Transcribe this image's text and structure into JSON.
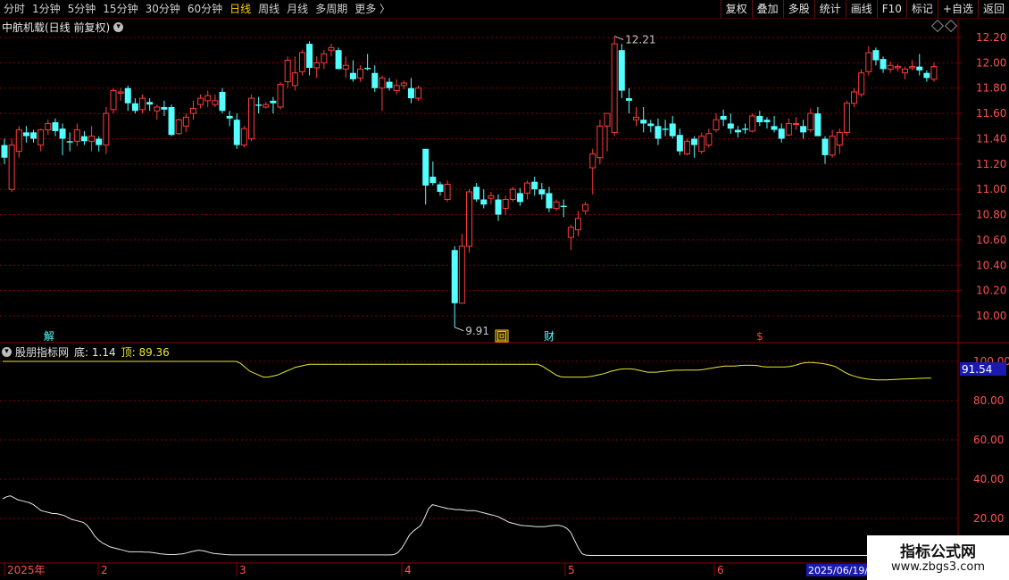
{
  "toolbar": {
    "periods": [
      "分时",
      "1分钟",
      "5分钟",
      "15分钟",
      "30分钟",
      "60分钟",
      "日线",
      "周线",
      "月线",
      "多周期",
      "更多 〉"
    ],
    "active_period": "日线",
    "buttons": [
      "复权",
      "叠加",
      "多股",
      "统计",
      "画线",
      "F10",
      "标记",
      "+自选",
      "返回"
    ]
  },
  "main_title": "中航机载(日线 前复权)",
  "indicator": {
    "name": "股朋指标网",
    "bottom_label": "底: 1.14",
    "top_label": "顶: 89.36",
    "current_value": "91.54",
    "axis_labels": [
      "100.00",
      "80.00",
      "60.00",
      "40.00",
      "20.00"
    ],
    "colors": {
      "bottom": "#e8e8e8",
      "top": "#e8e830"
    }
  },
  "price_axis": [
    "12.20",
    "12.00",
    "11.80",
    "11.60",
    "11.40",
    "11.20",
    "11.00",
    "10.80",
    "10.60",
    "10.40",
    "10.20",
    "10.00"
  ],
  "annotations": {
    "high": "12.21",
    "low": "9.91"
  },
  "event_badges": [
    "解",
    "回",
    "财",
    "$"
  ],
  "date_axis": [
    "2025年",
    "2",
    "3",
    "4",
    "5",
    "6",
    "2025/06/19/四"
  ],
  "watermark": {
    "title": "指标公式网",
    "url": "www.zbgs3.com"
  },
  "colors": {
    "up": "#ff3b3b",
    "down": "#54ffff",
    "grid": "#8a0000",
    "axis_text": "#ff5050"
  },
  "chart_data": {
    "type": "candlestick",
    "candles": [
      [
        11.35,
        11.4,
        11.2,
        11.25
      ],
      [
        11.0,
        11.4,
        10.98,
        11.35
      ],
      [
        11.3,
        11.5,
        11.25,
        11.47
      ],
      [
        11.45,
        11.5,
        11.37,
        11.42
      ],
      [
        11.45,
        11.47,
        11.37,
        11.4
      ],
      [
        11.35,
        11.48,
        11.3,
        11.47
      ],
      [
        11.47,
        11.55,
        11.43,
        11.52
      ],
      [
        11.53,
        11.56,
        11.42,
        11.46
      ],
      [
        11.48,
        11.52,
        11.27,
        11.4
      ],
      [
        11.38,
        11.45,
        11.3,
        11.37
      ],
      [
        11.38,
        11.52,
        11.34,
        11.47
      ],
      [
        11.42,
        11.46,
        11.35,
        11.38
      ],
      [
        11.38,
        11.5,
        11.3,
        11.42
      ],
      [
        11.4,
        11.42,
        11.3,
        11.35
      ],
      [
        11.35,
        11.65,
        11.28,
        11.6
      ],
      [
        11.63,
        11.8,
        11.6,
        11.78
      ],
      [
        11.76,
        11.8,
        11.7,
        11.77
      ],
      [
        11.8,
        11.82,
        11.62,
        11.68
      ],
      [
        11.68,
        11.72,
        11.6,
        11.62
      ],
      [
        11.63,
        11.75,
        11.6,
        11.72
      ],
      [
        11.69,
        11.72,
        11.62,
        11.67
      ],
      [
        11.62,
        11.67,
        11.55,
        11.65
      ],
      [
        11.65,
        11.7,
        11.58,
        11.63
      ],
      [
        11.65,
        11.67,
        11.42,
        11.43
      ],
      [
        11.44,
        11.56,
        11.43,
        11.55
      ],
      [
        11.5,
        11.6,
        11.45,
        11.57
      ],
      [
        11.6,
        11.7,
        11.55,
        11.64
      ],
      [
        11.67,
        11.75,
        11.64,
        11.72
      ],
      [
        11.7,
        11.78,
        11.65,
        11.74
      ],
      [
        11.67,
        11.75,
        11.65,
        11.7
      ],
      [
        11.77,
        11.8,
        11.6,
        11.62
      ],
      [
        11.58,
        11.62,
        11.5,
        11.56
      ],
      [
        11.55,
        11.6,
        11.32,
        11.35
      ],
      [
        11.35,
        11.5,
        11.33,
        11.48
      ],
      [
        11.4,
        11.75,
        11.38,
        11.72
      ],
      [
        11.67,
        11.73,
        11.6,
        11.66
      ],
      [
        11.65,
        11.69,
        11.64,
        11.67
      ],
      [
        11.7,
        11.73,
        11.6,
        11.68
      ],
      [
        11.65,
        11.85,
        11.63,
        11.83
      ],
      [
        11.85,
        12.05,
        11.8,
        12.02
      ],
      [
        11.82,
        12.05,
        11.78,
        11.92
      ],
      [
        11.93,
        12.1,
        11.9,
        12.08
      ],
      [
        12.15,
        12.17,
        11.9,
        11.96
      ],
      [
        11.96,
        12.05,
        11.88,
        12.0
      ],
      [
        12.0,
        12.1,
        11.95,
        12.07
      ],
      [
        12.1,
        12.15,
        12.05,
        12.12
      ],
      [
        12.1,
        12.12,
        11.95,
        11.95
      ],
      [
        11.95,
        12.05,
        11.88,
        11.98
      ],
      [
        11.92,
        12.02,
        11.85,
        11.87
      ],
      [
        11.88,
        11.98,
        11.85,
        11.95
      ],
      [
        11.96,
        12.07,
        11.94,
        11.95
      ],
      [
        11.92,
        11.98,
        11.77,
        11.8
      ],
      [
        11.8,
        11.9,
        11.62,
        11.88
      ],
      [
        11.85,
        11.88,
        11.78,
        11.8
      ],
      [
        11.78,
        11.87,
        11.75,
        11.82
      ],
      [
        11.82,
        11.86,
        11.79,
        11.84
      ],
      [
        11.8,
        11.88,
        11.68,
        11.72
      ],
      [
        11.72,
        11.82,
        11.7,
        11.8
      ],
      [
        11.32,
        11.32,
        10.88,
        11.03
      ],
      [
        11.1,
        11.22,
        11.03,
        11.05
      ],
      [
        11.04,
        11.06,
        10.95,
        10.98
      ],
      [
        10.92,
        11.07,
        10.9,
        11.04
      ],
      [
        10.52,
        10.55,
        9.91,
        10.1
      ],
      [
        10.1,
        10.65,
        10.1,
        10.55
      ],
      [
        10.55,
        11.0,
        10.5,
        10.98
      ],
      [
        11.02,
        11.05,
        10.9,
        10.92
      ],
      [
        10.92,
        11.0,
        10.85,
        10.88
      ],
      [
        10.93,
        10.98,
        10.88,
        10.95
      ],
      [
        10.92,
        10.96,
        10.75,
        10.8
      ],
      [
        10.85,
        10.95,
        10.8,
        10.92
      ],
      [
        10.92,
        11.02,
        10.9,
        11.0
      ],
      [
        10.97,
        11.01,
        10.87,
        10.9
      ],
      [
        10.97,
        11.07,
        10.92,
        11.05
      ],
      [
        11.06,
        11.1,
        10.95,
        11.0
      ],
      [
        11.0,
        11.05,
        10.92,
        10.96
      ],
      [
        10.97,
        11.02,
        10.82,
        10.85
      ],
      [
        10.85,
        10.92,
        10.83,
        10.9
      ],
      [
        10.87,
        10.92,
        10.78,
        10.86
      ],
      [
        10.62,
        10.72,
        10.52,
        10.7
      ],
      [
        10.68,
        10.83,
        10.63,
        10.77
      ],
      [
        10.83,
        10.9,
        10.8,
        10.88
      ],
      [
        11.17,
        11.32,
        10.96,
        11.28
      ],
      [
        11.25,
        11.55,
        11.2,
        11.5
      ],
      [
        11.5,
        11.6,
        11.3,
        11.6
      ],
      [
        11.45,
        12.21,
        11.42,
        12.15
      ],
      [
        12.1,
        12.15,
        11.72,
        11.78
      ],
      [
        11.72,
        11.8,
        11.6,
        11.7
      ],
      [
        11.55,
        11.65,
        11.5,
        11.57
      ],
      [
        11.55,
        11.65,
        11.45,
        11.52
      ],
      [
        11.52,
        11.55,
        11.45,
        11.5
      ],
      [
        11.5,
        11.56,
        11.35,
        11.4
      ],
      [
        11.48,
        11.55,
        11.42,
        11.47
      ],
      [
        11.52,
        11.58,
        11.4,
        11.42
      ],
      [
        11.43,
        11.48,
        11.27,
        11.3
      ],
      [
        11.28,
        11.4,
        11.27,
        11.38
      ],
      [
        11.4,
        11.42,
        11.25,
        11.35
      ],
      [
        11.3,
        11.45,
        11.28,
        11.42
      ],
      [
        11.35,
        11.48,
        11.33,
        11.44
      ],
      [
        11.47,
        11.6,
        11.45,
        11.55
      ],
      [
        11.58,
        11.63,
        11.5,
        11.55
      ],
      [
        11.52,
        11.6,
        11.44,
        11.48
      ],
      [
        11.47,
        11.5,
        11.41,
        11.45
      ],
      [
        11.48,
        11.52,
        11.44,
        11.47
      ],
      [
        11.46,
        11.6,
        11.45,
        11.58
      ],
      [
        11.58,
        11.62,
        11.5,
        11.53
      ],
      [
        11.55,
        11.57,
        11.48,
        11.53
      ],
      [
        11.5,
        11.58,
        11.45,
        11.47
      ],
      [
        11.48,
        11.52,
        11.37,
        11.4
      ],
      [
        11.43,
        11.56,
        11.42,
        11.52
      ],
      [
        11.52,
        11.57,
        11.47,
        11.52
      ],
      [
        11.5,
        11.55,
        11.4,
        11.45
      ],
      [
        11.47,
        11.64,
        11.45,
        11.6
      ],
      [
        11.6,
        11.65,
        11.43,
        11.42
      ],
      [
        11.4,
        11.42,
        11.2,
        11.27
      ],
      [
        11.27,
        11.47,
        11.25,
        11.42
      ],
      [
        11.35,
        11.48,
        11.28,
        11.45
      ],
      [
        11.45,
        11.7,
        11.42,
        11.68
      ],
      [
        11.68,
        11.8,
        11.65,
        11.77
      ],
      [
        11.75,
        11.95,
        11.73,
        11.92
      ],
      [
        11.93,
        12.13,
        11.9,
        12.08
      ],
      [
        12.1,
        12.12,
        11.98,
        12.02
      ],
      [
        12.03,
        12.05,
        11.92,
        11.95
      ],
      [
        11.95,
        12.01,
        11.92,
        11.98
      ],
      [
        11.96,
        11.99,
        11.93,
        11.97
      ],
      [
        11.92,
        11.97,
        11.87,
        11.95
      ],
      [
        11.96,
        12.02,
        11.94,
        11.97
      ],
      [
        11.97,
        12.07,
        11.9,
        11.94
      ],
      [
        11.92,
        11.94,
        11.85,
        11.88
      ],
      [
        11.87,
        12.0,
        11.85,
        11.97
      ]
    ],
    "indicator_top": [
      100,
      100,
      100,
      100,
      100,
      100,
      100,
      100,
      100,
      100,
      100,
      100,
      100,
      100,
      100,
      100,
      100,
      100,
      100,
      100,
      100,
      100,
      100,
      100,
      100,
      100,
      100,
      100,
      100,
      100,
      100,
      100,
      100,
      100,
      100,
      100,
      100,
      100,
      100,
      100,
      100,
      100,
      100,
      100,
      100,
      100,
      100,
      100,
      100,
      100,
      100,
      100,
      99,
      97,
      95,
      94,
      93,
      92,
      92,
      92.5,
      93,
      94,
      95,
      96,
      97,
      97.5,
      98,
      98.5,
      98.5,
      98.5,
      98.5,
      98.5,
      98.5,
      98.5,
      98.5,
      98.5,
      98.5,
      98.5,
      98.5,
      98.5,
      98.5,
      98.5,
      98.5,
      98.5,
      98.5,
      98.5,
      98.5,
      98.5,
      98.5,
      98.5,
      98.5,
      98.5,
      98.5,
      98.5,
      98.5,
      98.5,
      98.5,
      98.5,
      98.5,
      98.5,
      98.5,
      98.5,
      98.5,
      98.5,
      98.5,
      98.5,
      98.5,
      98.5,
      98.5,
      98.5,
      98.5,
      98.5,
      98.5,
      98.5,
      98.5,
      98.5,
      98.5,
      98.5,
      97.5,
      96,
      94.5,
      93,
      92.2,
      92,
      92,
      92,
      92,
      92,
      92.2,
      92.5,
      93,
      93.5,
      94.2,
      95,
      95.5,
      96,
      96.2,
      96.2,
      96,
      95.5,
      95,
      94.5,
      94.5,
      94.5,
      94.8,
      95,
      95.3,
      95.5,
      95.5,
      95.6,
      95.6,
      95.6,
      95.6,
      95.8,
      96.2,
      96.6,
      97,
      97.3,
      97.6,
      97.6,
      97.6,
      97.8,
      98,
      98,
      98,
      97.8,
      97.4,
      97.2,
      97.2,
      97.2,
      97.2,
      97.2,
      97.4,
      97.8,
      98.6,
      99.2,
      99.4,
      99.4,
      99.2,
      99,
      98.6,
      98,
      97.4,
      96,
      94.6,
      93.4,
      92.6,
      91.9,
      91.4,
      91,
      90.8,
      90.6,
      90.6,
      90.6,
      90.7,
      90.8,
      90.9,
      91,
      91.1,
      91.2,
      91.3,
      91.4,
      91.5,
      91.5
    ],
    "indicator_bottom": [
      30,
      31,
      31.5,
      30.5,
      29.5,
      29,
      28.5,
      28,
      27,
      25.5,
      24,
      23.5,
      23,
      22.5,
      22.5,
      22,
      21.5,
      20.5,
      19.5,
      19,
      18.5,
      18,
      16.5,
      14,
      11,
      9,
      7.5,
      6.5,
      5.5,
      5,
      4.5,
      4,
      3.5,
      3,
      3,
      3,
      3,
      2.8,
      2.8,
      2.6,
      2.3,
      2,
      1.8,
      1.6,
      1.6,
      1.6,
      1.8,
      2,
      2.4,
      3,
      3.4,
      3.8,
      3.6,
      3.2,
      2.6,
      2.2,
      2,
      1.8,
      1.6,
      1.5,
      1.4,
      1.4,
      1.4,
      1.4,
      1.4,
      1.4,
      1.4,
      1.4,
      1.4,
      1.4,
      1.4,
      1.4,
      1.4,
      1.4,
      1.4,
      1.4,
      1.4,
      1.4,
      1.4,
      1.4,
      1.4,
      1.4,
      1.4,
      1.4,
      1.4,
      1.4,
      1.4,
      1.4,
      1.4,
      1.4,
      1.4,
      1.4,
      1.4,
      1.4,
      1.4,
      1.4,
      1.4,
      1.4,
      1.4,
      1.4,
      1.4,
      1.4,
      1.6,
      2.6,
      4.8,
      8,
      11.5,
      13.5,
      15,
      16.5,
      20.5,
      25,
      27,
      26.5,
      26,
      25.5,
      25,
      24.8,
      24.5,
      24.5,
      24.3,
      24,
      24,
      24,
      23.5,
      23,
      22.5,
      22,
      21.5,
      21,
      20,
      19,
      18,
      17.5,
      17,
      16.5,
      16.3,
      16.2,
      16,
      15.8,
      15.8,
      15.8,
      16,
      16.3,
      16.5,
      16.5,
      16,
      15,
      13,
      9,
      5,
      2,
      1.3,
      1.14,
      1.14,
      1.14,
      1.14,
      1.14,
      1.14,
      1.14,
      1.14,
      1.14,
      1.14,
      1.14,
      1.14,
      1.14,
      1.14,
      1.14,
      1.14,
      1.14,
      1.14,
      1.14,
      1.14,
      1.14,
      1.14,
      1.14,
      1.14,
      1.14,
      1.14,
      1.14,
      1.14,
      1.14,
      1.14,
      1.14,
      1.14,
      1.14,
      1.14,
      1.14,
      1.14,
      1.14,
      1.14,
      1.14,
      1.14,
      1.14,
      1.14,
      1.14,
      1.14,
      1.14,
      1.14,
      1.14,
      1.14,
      1.14,
      1.14,
      1.14,
      1.14,
      1.14,
      1.14,
      1.14,
      1.14,
      1.14,
      1.14,
      1.14,
      1.14,
      1.14,
      1.14,
      1.14,
      1.14,
      1.14,
      1.14,
      1.14,
      1.14,
      1.14,
      1.14,
      1.14,
      1.14,
      1.14,
      1.14,
      1.14,
      1.14,
      1.14,
      1.14,
      1.14,
      1.14,
      1.14,
      1.14,
      1.14,
      1.14,
      1.14,
      1.14,
      1.14,
      1.14,
      1.14,
      1.14
    ],
    "price_ylim": [
      9.87,
      12.27
    ],
    "indicator_ylim": [
      0,
      105
    ],
    "grid": true
  }
}
